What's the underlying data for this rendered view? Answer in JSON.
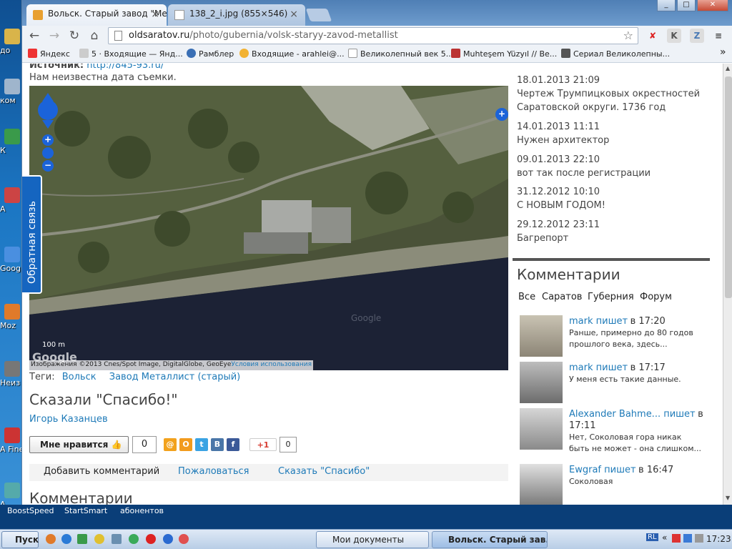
{
  "browser": {
    "tabs": [
      {
        "title": "Вольск. Старый завод \"Ме",
        "active": true
      },
      {
        "title": "138_2_i.jpg (855×546)",
        "active": false
      }
    ],
    "url_host": "oldsaratov.ru",
    "url_path": "/photo/gubernia/volsk-staryy-zavod-metallist",
    "bookmarks": [
      "Яндекс",
      "5 · Входящие — Янд...",
      "Рамблер",
      "Входящие - arahlei@...",
      "Великолепный век 5...",
      "Muhteşem Yüzyıl // Ве...",
      "Сериал Великолепны..."
    ],
    "window_buttons": [
      "_",
      "□",
      "✕"
    ]
  },
  "page": {
    "source_label": "Источник:",
    "source_value": "http://845-93.ru/",
    "date_note": "Нам неизвестна дата съемки.",
    "map": {
      "scale": "100 m",
      "brand": "Google",
      "copyright": "Изображения ©2013 Cnes/Spot Image, DigitalGlobe, GeoEye",
      "terms": "Условия использования",
      "watermark": "Google"
    },
    "tags_label": "Теги:",
    "tags": [
      "Вольск",
      "Завод Металлист (старый)"
    ],
    "thanks_heading": "Сказали \"Спасибо!\"",
    "thanks_user": "Игорь Казанцев",
    "like_label": "Мне нравится",
    "like_count": "0",
    "gplus_label": "+1",
    "gplus_count": "0",
    "actions": [
      "Добавить комментарий",
      "Пожаловаться",
      "Сказать \"Спасибо\""
    ],
    "bottom_heading": "Комментарии",
    "feedback": "Обратная связь"
  },
  "sidebar": {
    "news": [
      {
        "date": "18.01.2013 21:09",
        "title_line1": "Чертеж Трумпицковых окрестностей",
        "title_line2": "Саратовской округи. 1736 год"
      },
      {
        "date": "14.01.2013 11:11",
        "title_line1": "Нужен архитектор",
        "title_line2": ""
      },
      {
        "date": "09.01.2013 22:10",
        "title_line1": "вот так после регистрации",
        "title_line2": ""
      },
      {
        "date": "31.12.2012 10:10",
        "title_line1": "С НОВЫМ ГОДОМ!",
        "title_line2": ""
      },
      {
        "date": "29.12.2012 23:11",
        "title_line1": "Багрепорт",
        "title_line2": ""
      }
    ],
    "comments_heading": "Комментарии",
    "filters": [
      "Все",
      "Саратов",
      "Губерния",
      "Форум"
    ],
    "comments": [
      {
        "author": "mark пишет",
        "time": "в 17:20",
        "line1": "Ранше, примерно до 80 годов",
        "line2": "прошлого века, здесь..."
      },
      {
        "author": "mark пишет",
        "time": "в 17:17",
        "line1": "У  меня есть такие данные.",
        "line2": ""
      },
      {
        "author": "Alexander Bahme... пишет",
        "time": "в 17:11",
        "line1": "Нет, Соколовая гора никак",
        "line2": "быть не может - она слишком..."
      },
      {
        "author": "Ewgraf пишет",
        "time": "в 16:47",
        "line1": "Соколовая",
        "line2": ""
      }
    ]
  },
  "desktop": {
    "icons": [
      "до",
      "ком",
      "К",
      "А",
      "Goog",
      "Moz",
      "Неиз я",
      "А Fine",
      "А"
    ],
    "strip": [
      "BoostSpeed",
      "StartSmart",
      "абонентов"
    ]
  },
  "taskbar": {
    "start": "Пуск",
    "tasks": [
      "Мои документы",
      "Вольск. Старый зав..."
    ],
    "lang": "RL",
    "time": "17:23"
  },
  "colors": {
    "link": "#1e7ab8",
    "feedback": "#1565c0",
    "sidebar_sep": "#555555"
  }
}
